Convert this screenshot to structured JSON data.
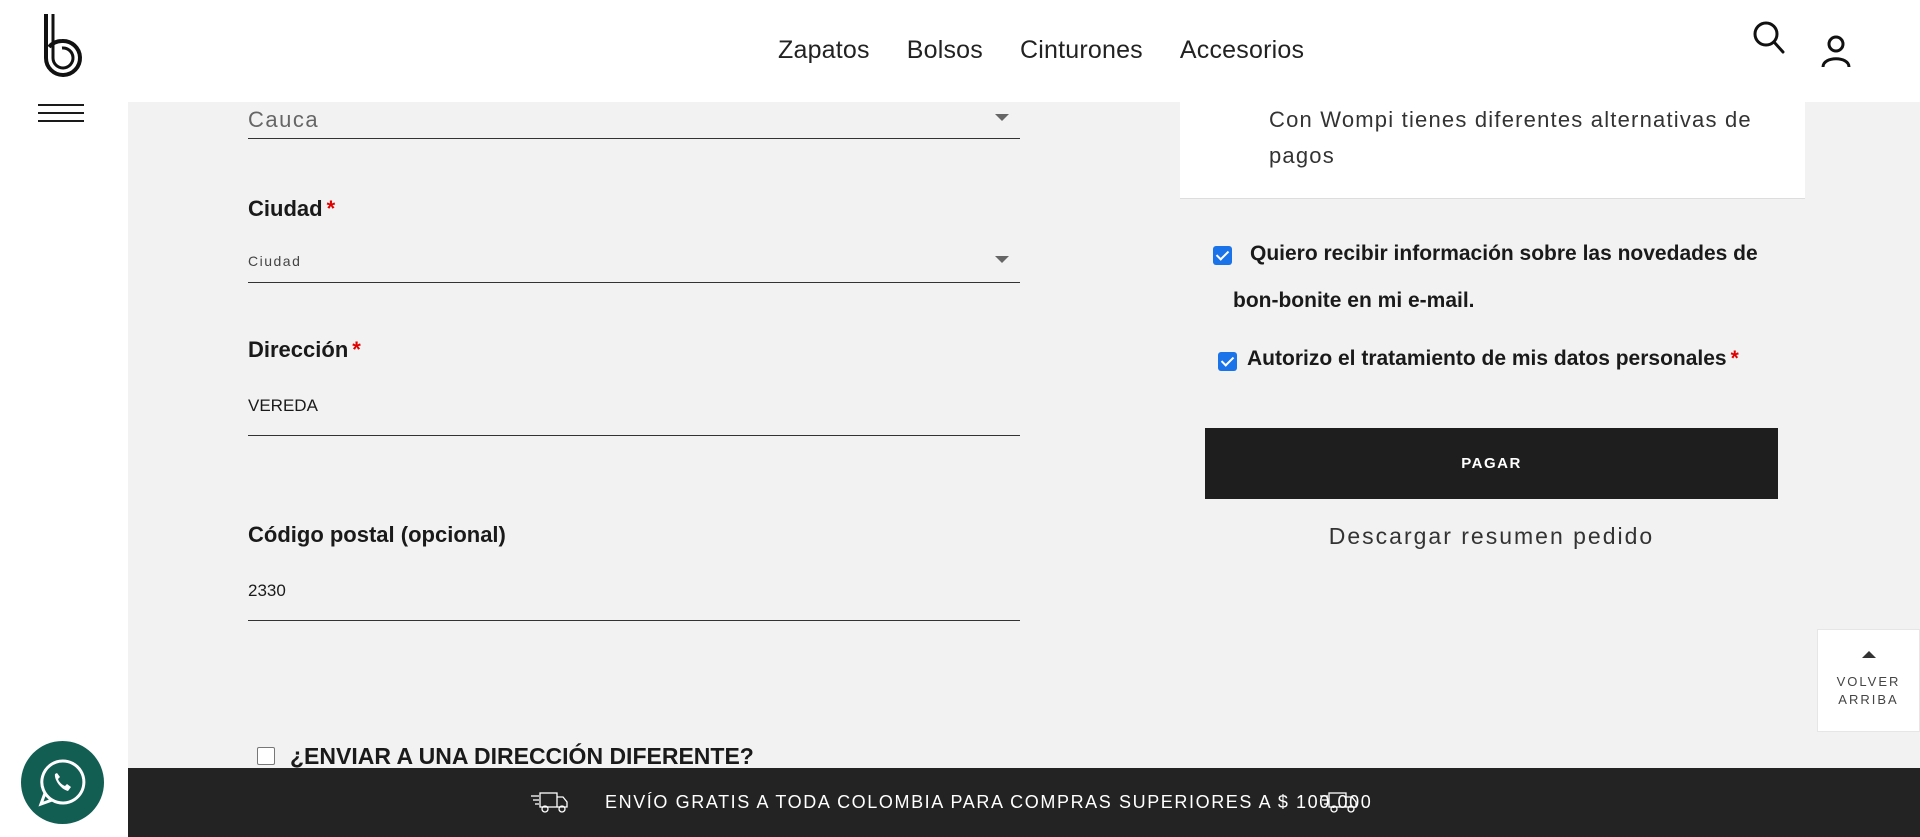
{
  "header": {
    "nav": [
      "Zapatos",
      "Bolsos",
      "Cinturones",
      "Accesorios"
    ]
  },
  "form": {
    "state_value": "Cauca",
    "city_label": "Ciudad",
    "city_placeholder": "Ciudad",
    "address_label": "Dirección",
    "address_value": "VEREDA",
    "postal_label": "Código postal (opcional)",
    "postal_value": "2330",
    "required_mark": "*",
    "ship_different_label": "¿ENVIAR A UNA DIRECCIÓN DIFERENTE?"
  },
  "payment": {
    "wompi_text": "Con Wompi tienes diferentes alternativas de pagos",
    "newsletter_line1": "Quiero recibir información sobre las novedades de",
    "newsletter_line2": "bon-bonite en mi e-mail.",
    "privacy_label": "Autorizo el tratamiento de mis datos personales",
    "pay_button": "PAGAR",
    "download_link": "Descargar resumen pedido"
  },
  "back_to_top": {
    "line1": "VOLVER",
    "line2": "ARRIBA"
  },
  "banner": {
    "text": "ENVÍO GRATIS A TODA COLOMBIA PARA COMPRAS SUPERIORES A $ 100.000"
  },
  "colors": {
    "accent_checkbox": "#1a73e8",
    "whatsapp_bg": "#125e53",
    "required": "#e00000",
    "bottom_bar": "#232323"
  }
}
